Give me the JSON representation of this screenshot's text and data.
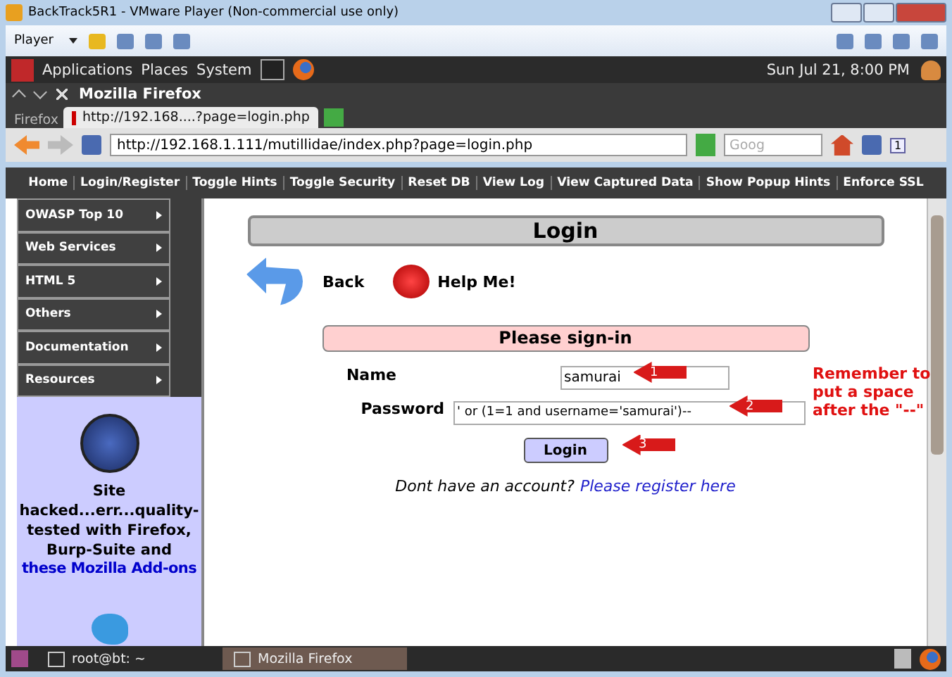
{
  "window": {
    "title": "BackTrack5R1 - VMware Player (Non-commercial use only)"
  },
  "vm_toolbar": {
    "menu": "Player"
  },
  "desktop_panel": {
    "menus": [
      "Applications",
      "Places",
      "System"
    ],
    "clock": "Sun Jul 21,  8:00 PM"
  },
  "browser": {
    "title": "Mozilla Firefox",
    "app_menu": "Firefox",
    "tab": "http://192.168....?page=login.php",
    "url": "http://192.168.1.111/mutillidae/index.php?page=login.php",
    "search_placeholder": "Goog",
    "badge": "1"
  },
  "site_nav": [
    "Home",
    "Login/Register",
    "Toggle Hints",
    "Toggle Security",
    "Reset DB",
    "View Log",
    "View Captured Data",
    "Show Popup Hints",
    "Enforce SSL"
  ],
  "sidebar": {
    "items": [
      "OWASP Top 10",
      "Web Services",
      "HTML 5",
      "Others",
      "Documentation",
      "Resources"
    ],
    "blurb": "Site hacked...err...quality-tested with Firefox, Burp-Suite and",
    "link": "these Mozilla Add-ons"
  },
  "page": {
    "title": "Login",
    "back": "Back",
    "help": "Help Me!",
    "form_title": "Please sign-in",
    "fields": [
      {
        "label": "Name",
        "value": "samurai",
        "marker": "1"
      },
      {
        "label": "Password",
        "value": "' or (1=1 and username='samurai')--",
        "marker": "2"
      }
    ],
    "submit": "Login",
    "submit_marker": "3",
    "register_prompt": "Dont have an account?",
    "register_link": "Please register here"
  },
  "note": "Remember to put a space after the \"--\"",
  "taskbar": {
    "items": [
      {
        "label": "root@bt: ~",
        "selected": false
      },
      {
        "label": "Mozilla Firefox",
        "selected": true
      }
    ]
  }
}
